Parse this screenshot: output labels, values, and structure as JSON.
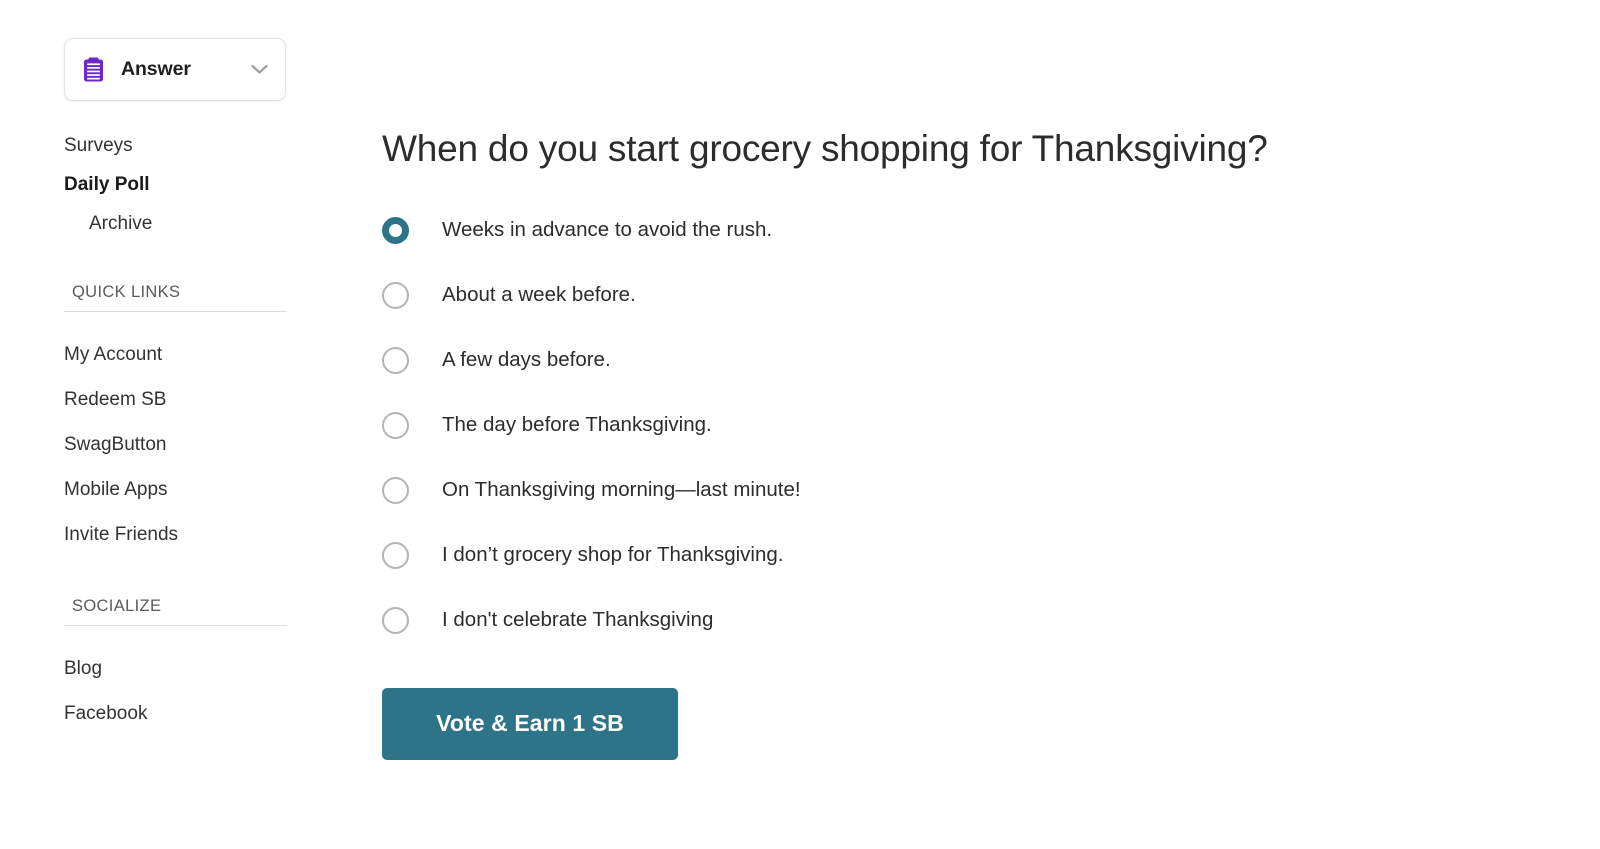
{
  "sidebar": {
    "answer_menu": {
      "label": "Answer",
      "icon": "clipboard-icon",
      "chevron_icon": "chevron-down-icon",
      "icon_color": "#6d28c9"
    },
    "primary_nav": [
      {
        "label": "Surveys",
        "active": false,
        "indent": false
      },
      {
        "label": "Daily Poll",
        "active": true,
        "indent": false
      },
      {
        "label": "Archive",
        "active": false,
        "indent": true
      }
    ],
    "quick_links": {
      "title": "QUICK LINKS",
      "items": [
        {
          "label": "My Account"
        },
        {
          "label": "Redeem SB"
        },
        {
          "label": "SwagButton"
        },
        {
          "label": "Mobile Apps"
        },
        {
          "label": "Invite Friends"
        }
      ]
    },
    "socialize": {
      "title": "SOCIALIZE",
      "items": [
        {
          "label": "Blog"
        },
        {
          "label": "Facebook"
        }
      ]
    }
  },
  "main": {
    "question": "When do you start grocery shopping for Thanksgiving?",
    "options": [
      {
        "label": "Weeks in advance to avoid the rush.",
        "selected": true
      },
      {
        "label": "About a week before.",
        "selected": false
      },
      {
        "label": "A few days before.",
        "selected": false
      },
      {
        "label": "The day before Thanksgiving.",
        "selected": false
      },
      {
        "label": "On Thanksgiving morning—last minute!",
        "selected": false
      },
      {
        "label": "I don’t grocery shop for Thanksgiving.",
        "selected": false
      },
      {
        "label": "I don't celebrate Thanksgiving",
        "selected": false
      }
    ],
    "submit_label": "Vote & Earn 1 SB"
  },
  "colors": {
    "accent_teal": "#2e7489",
    "icon_purple": "#6d28c9",
    "text": "#2c2c2c"
  }
}
